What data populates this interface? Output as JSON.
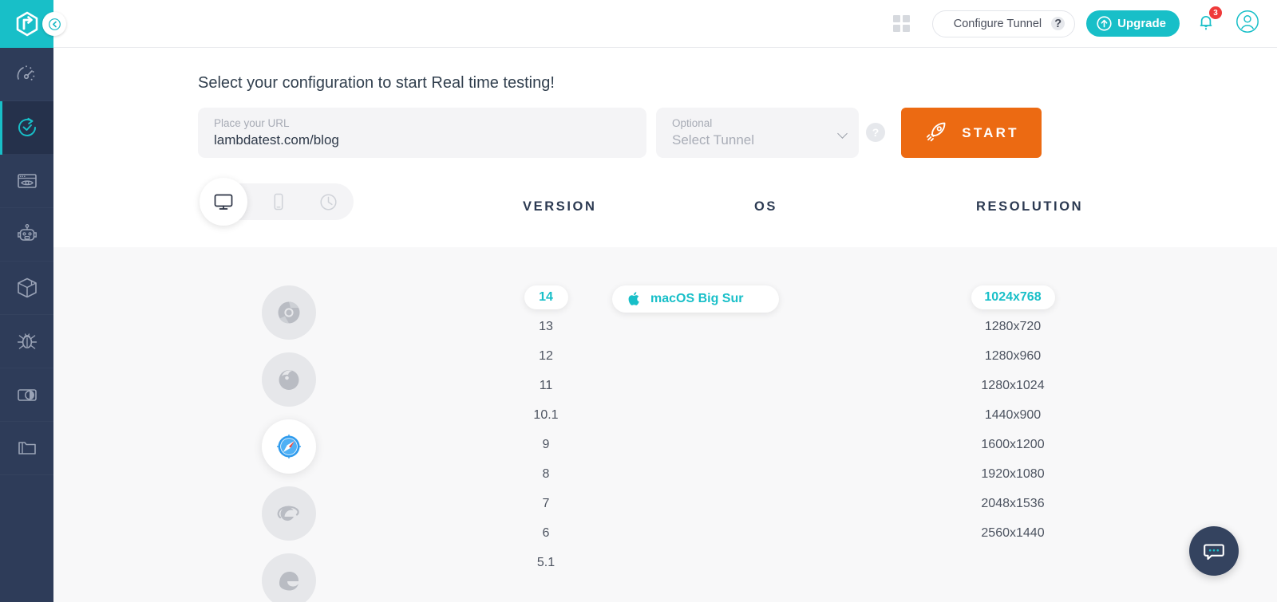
{
  "brand": {
    "logo_name": "lambdatest-logo",
    "accent_teal": "#18bfc8",
    "accent_orange": "#ec6a12",
    "sidebar_navy": "#2e3c59",
    "badge_red": "#ef3a3a"
  },
  "sidebar": {
    "collapse_label": "chevron-left-icon",
    "items": [
      {
        "name": "dashboard",
        "icon": "speedometer-icon",
        "active": false
      },
      {
        "name": "real-time",
        "icon": "realtime-clock-icon",
        "active": true
      },
      {
        "name": "screenshot",
        "icon": "screenshot-eye-icon",
        "active": false
      },
      {
        "name": "automation",
        "icon": "robot-icon",
        "active": false
      },
      {
        "name": "app-testing",
        "icon": "box-package-icon",
        "active": false
      },
      {
        "name": "bug-tracking",
        "icon": "bug-icon",
        "active": false
      },
      {
        "name": "smart-visual",
        "icon": "visual-compare-icon",
        "active": false
      },
      {
        "name": "projects",
        "icon": "folder-icon",
        "active": false
      }
    ]
  },
  "header": {
    "grid_icon": "apps-grid-icon",
    "tunnel_label": "Configure Tunnel",
    "tunnel_help_glyph": "?",
    "upgrade_label": "Upgrade",
    "upgrade_icon": "arrow-up-circle-icon",
    "bell_icon": "notification-bell-icon",
    "notification_count": "3",
    "avatar_icon": "user-avatar-icon"
  },
  "config": {
    "title": "Select your configuration to start Real time testing!",
    "url_field": {
      "label": "Place your URL",
      "value": "lambdatest.com/blog",
      "placeholder": "Place your URL"
    },
    "tunnel_field": {
      "label": "Optional",
      "value": "Select Tunnel",
      "placeholder": "Select Tunnel"
    },
    "tunnel_help_glyph": "?",
    "start_button": {
      "label": "START",
      "icon": "rocket-icon"
    },
    "device_toggle": [
      {
        "name": "desktop",
        "icon": "desktop-monitor-icon",
        "active": true
      },
      {
        "name": "mobile",
        "icon": "mobile-phone-icon",
        "active": false
      },
      {
        "name": "history",
        "icon": "history-clock-icon",
        "active": false
      }
    ],
    "columns": {
      "version": "VERSION",
      "os": "OS",
      "resolution": "RESOLUTION"
    }
  },
  "selection": {
    "browsers": [
      {
        "name": "chrome",
        "icon": "chrome-icon",
        "active": false
      },
      {
        "name": "firefox",
        "icon": "firefox-icon",
        "active": false
      },
      {
        "name": "safari",
        "icon": "safari-icon",
        "active": true
      },
      {
        "name": "internet-explorer",
        "icon": "internet-explorer-icon",
        "active": false
      },
      {
        "name": "edge",
        "icon": "edge-icon",
        "active": false
      }
    ],
    "versions": [
      {
        "label": "14",
        "active": true
      },
      {
        "label": "13",
        "active": false
      },
      {
        "label": "12",
        "active": false
      },
      {
        "label": "11",
        "active": false
      },
      {
        "label": "10.1",
        "active": false
      },
      {
        "label": "9",
        "active": false
      },
      {
        "label": "8",
        "active": false
      },
      {
        "label": "7",
        "active": false
      },
      {
        "label": "6",
        "active": false
      },
      {
        "label": "5.1",
        "active": false
      }
    ],
    "os_list": [
      {
        "label": "macOS Big Sur",
        "icon": "apple-icon",
        "active": true
      }
    ],
    "resolutions": [
      {
        "label": "1024x768",
        "active": true
      },
      {
        "label": "1280x720",
        "active": false
      },
      {
        "label": "1280x960",
        "active": false
      },
      {
        "label": "1280x1024",
        "active": false
      },
      {
        "label": "1440x900",
        "active": false
      },
      {
        "label": "1600x1200",
        "active": false
      },
      {
        "label": "1920x1080",
        "active": false
      },
      {
        "label": "2048x1536",
        "active": false
      },
      {
        "label": "2560x1440",
        "active": false
      }
    ]
  },
  "chat": {
    "icon": "chat-bubble-icon"
  }
}
